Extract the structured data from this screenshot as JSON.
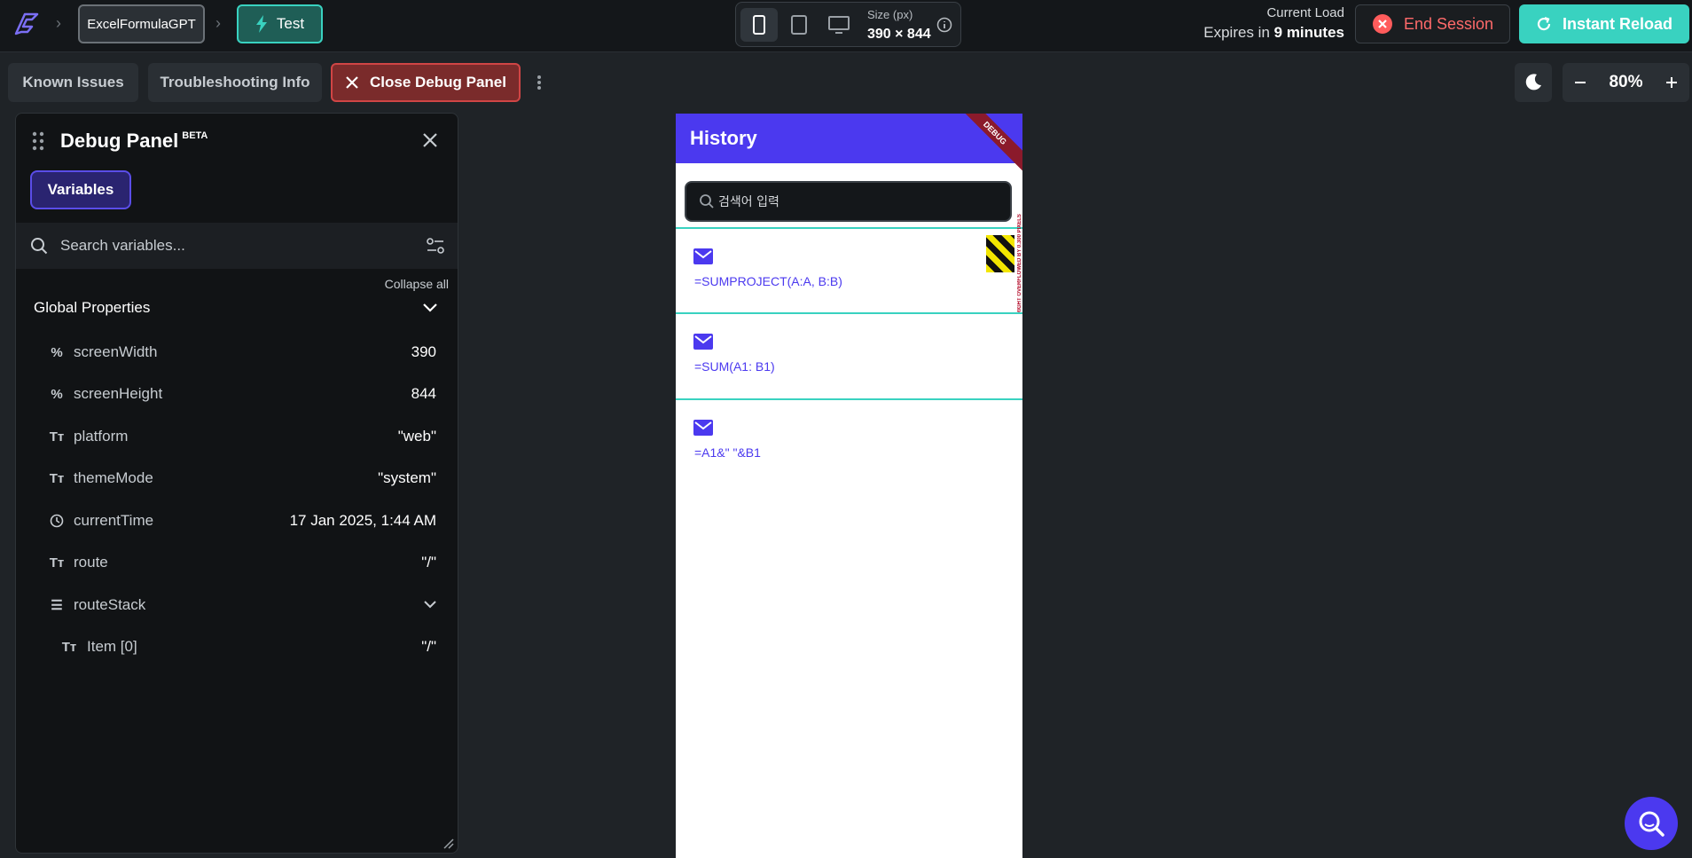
{
  "topbar": {
    "project_name": "ExcelFormulaGPT",
    "test_label": "Test",
    "size_label": "Size (px)",
    "size_value": "390 × 844",
    "load_label": "Current Load",
    "expires_prefix": "Expires in",
    "expires_value": "9 minutes",
    "end_session_label": "End Session",
    "instant_reload_label": "Instant Reload"
  },
  "subbar": {
    "known_issues_label": "Known Issues",
    "troubleshooting_label": "Troubleshooting Info",
    "close_debug_label": "Close Debug Panel",
    "zoom_value": "80%"
  },
  "debug_panel": {
    "title": "Debug Panel",
    "beta_badge": "BETA",
    "tab_variables": "Variables",
    "search_placeholder": "Search variables...",
    "collapse_all": "Collapse all",
    "section_title": "Global Properties",
    "variables": [
      {
        "icon": "percent-icon",
        "name": "screenWidth",
        "value": "390"
      },
      {
        "icon": "percent-icon",
        "name": "screenHeight",
        "value": "844"
      },
      {
        "icon": "text-type-icon",
        "name": "platform",
        "value": "\"web\""
      },
      {
        "icon": "text-type-icon",
        "name": "themeMode",
        "value": "\"system\""
      },
      {
        "icon": "clock-icon",
        "name": "currentTime",
        "value": "17 Jan 2025, 1:44 AM"
      },
      {
        "icon": "text-type-icon",
        "name": "route",
        "value": "\"/\""
      },
      {
        "icon": "list-icon",
        "name": "routeStack",
        "value": ""
      },
      {
        "icon": "text-type-icon",
        "name": "Item [0]",
        "value": "\"/\""
      }
    ]
  },
  "phone": {
    "title": "History",
    "debug_ribbon": "DEBUG",
    "search_placeholder": "검색어 입력",
    "overflow_text": "RIGHT OVERFLOWED BY 0.300 PIXELS",
    "history": [
      {
        "formula": "=SUMPROJECT(A:A, B:B)"
      },
      {
        "formula": "=SUM(A1: B1)"
      },
      {
        "formula": "=A1&\" \"&B1"
      }
    ]
  },
  "colors": {
    "accent_teal": "#39d2c0",
    "primary_purple": "#4b39ef",
    "danger_red": "#ff6a6a"
  }
}
